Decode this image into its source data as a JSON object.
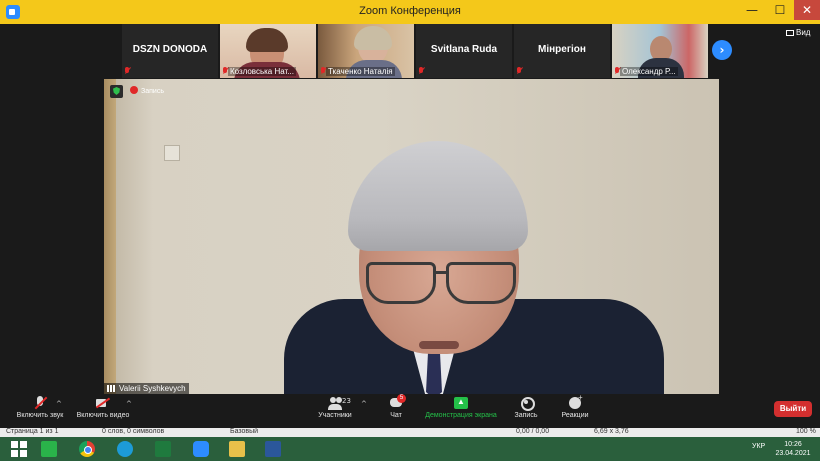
{
  "window": {
    "title": "Zoom Конференция",
    "min": "—",
    "max": "☐",
    "close": "✕"
  },
  "strip": {
    "tiles": [
      {
        "name": "DSZN DONODA",
        "video": false
      },
      {
        "name": "Козловська Нат...",
        "video": true
      },
      {
        "name": "Ткаченко Наталія",
        "video": true
      },
      {
        "name": "Svitlana Ruda",
        "video": false
      },
      {
        "name": "Мінрегіон",
        "video": false
      },
      {
        "name": "Олександр Р...",
        "video": true
      }
    ],
    "next": "›",
    "view_label": "Вид"
  },
  "speaker": {
    "record_label": "Запись",
    "name": "Valerii Syshkevych"
  },
  "toolbar": {
    "unmute": "Включить звук",
    "start_video": "Включить видео",
    "participants": "Участники",
    "participants_count": "23",
    "chat": "Чат",
    "chat_badge": "5",
    "share": "Демонстрация экрана",
    "record": "Запись",
    "reactions": "Реакции",
    "leave": "Выйти",
    "caret": "^"
  },
  "wordbar": {
    "page": "Страница 1 из 1",
    "words": "0 слов, 0 символов",
    "style": "Базовый",
    "pos1": "0,00 / 0,00",
    "pos2": "6,69 x 3,76",
    "zoom": "100 %"
  },
  "taskbar": {
    "lang": "УКР",
    "time": "10:26",
    "date": "23.04.2021"
  }
}
